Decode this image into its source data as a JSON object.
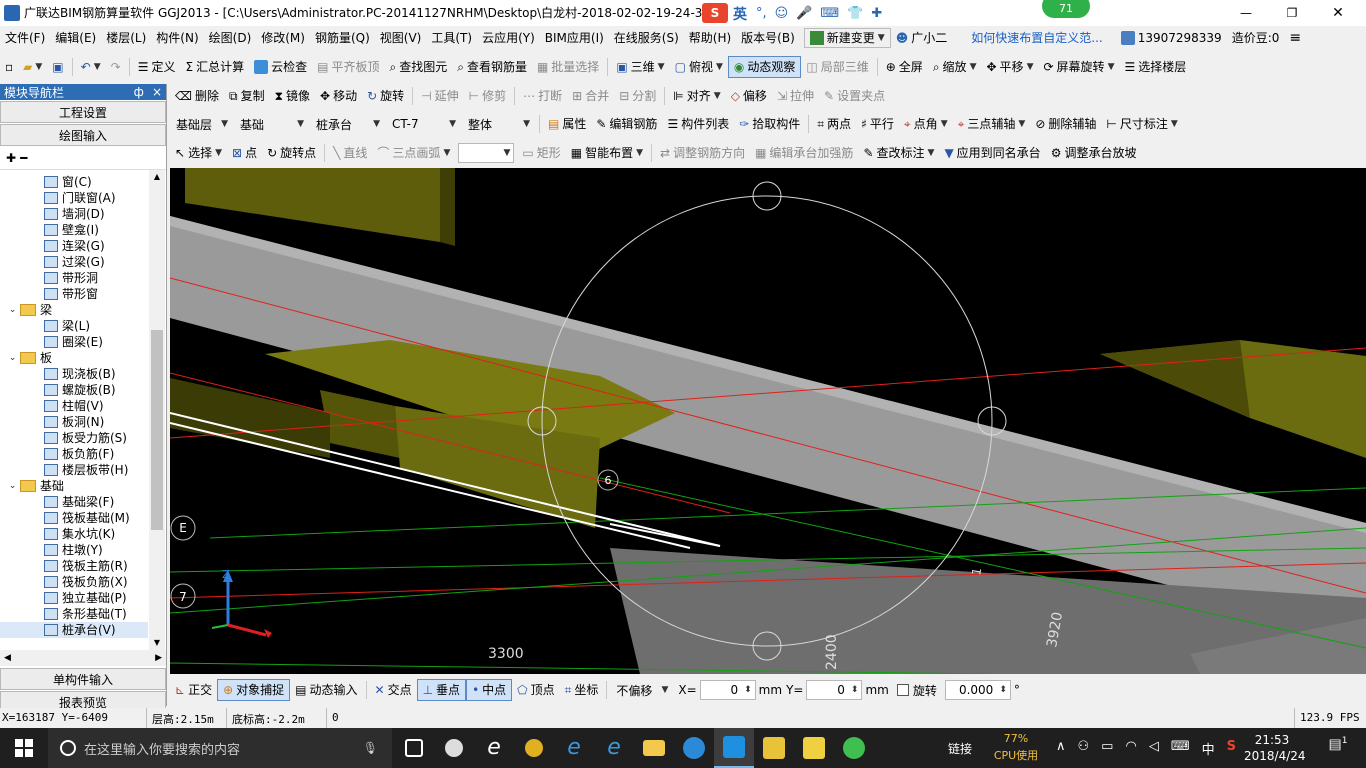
{
  "titlebar": {
    "title": "广联达BIM钢筋算量软件 GGJ2013 - [C:\\Users\\Administrator.PC-20141127NRHM\\Desktop\\白龙村-2018-02-02-19-24-35",
    "ime_label": "英",
    "badge_count": "71",
    "minimize": "—",
    "maximize": "❐",
    "close": "✕"
  },
  "menubar": {
    "items": [
      "文件(F)",
      "编辑(E)",
      "楼层(L)",
      "构件(N)",
      "绘图(D)",
      "修改(M)",
      "钢筋量(Q)",
      "视图(V)",
      "工具(T)",
      "云应用(Y)",
      "BIM应用(I)",
      "在线服务(S)",
      "帮助(H)",
      "版本号(B)"
    ],
    "new_change": "新建变更",
    "assistant": "广小二",
    "help_link": "如何快速布置自定义范...",
    "phone": "13907298339",
    "price_beans": "造价豆:0"
  },
  "toolbar1": {
    "define": "定义",
    "sum_calc": "汇总计算",
    "cloud_check": "云检查",
    "flush_slab_top": "平齐板顶",
    "find_element": "查找图元",
    "view_rebar": "查看钢筋量",
    "batch_select": "批量选择",
    "three_d": "三维",
    "top_view": "俯视",
    "dynamic_observe": "动态观察",
    "local_3d": "局部三维",
    "full_screen": "全屏",
    "zoom": "缩放",
    "pan": "平移",
    "screen_rotate": "屏幕旋转",
    "select_floor": "选择楼层"
  },
  "toolbar2": {
    "delete": "删除",
    "copy": "复制",
    "mirror": "镜像",
    "move": "移动",
    "rotate": "旋转",
    "extend": "延伸",
    "trim": "修剪",
    "break": "打断",
    "merge": "合并",
    "split": "分割",
    "align": "对齐",
    "offset": "偏移",
    "stretch": "拉伸",
    "set_grip": "设置夹点"
  },
  "toolbar3": {
    "floor": "基础层",
    "category": "基础",
    "element_type": "桩承台",
    "element_name": "CT-7",
    "unit": "整体",
    "properties": "属性",
    "edit_rebar": "编辑钢筋",
    "element_list": "构件列表",
    "pick_element": "拾取构件",
    "two_points": "两点",
    "parallel": "平行",
    "point_angle": "点角",
    "three_point_axis": "三点辅轴",
    "delete_axis": "删除辅轴",
    "dimension": "尺寸标注"
  },
  "toolbar4": {
    "select": "选择",
    "point": "点",
    "rotate_point": "旋转点",
    "line": "直线",
    "three_point_arc": "三点画弧",
    "rectangle": "矩形",
    "smart_layout": "智能布置",
    "adjust_rebar_dir": "调整钢筋方向",
    "edit_cap_rebar": "编辑承台加强筋",
    "modify_label": "查改标注",
    "apply_same_name": "应用到同名承台",
    "adjust_cap_slope": "调整承台放坡"
  },
  "nav": {
    "header": "模块导航栏",
    "pin": "ф",
    "close": "×",
    "engineering_settings": "工程设置",
    "drawing_input": "绘图输入",
    "tree": [
      {
        "label": "窗(C)",
        "kind": "item"
      },
      {
        "label": "门联窗(A)",
        "kind": "item"
      },
      {
        "label": "墙洞(D)",
        "kind": "item"
      },
      {
        "label": "壁龛(I)",
        "kind": "item"
      },
      {
        "label": "连梁(G)",
        "kind": "item"
      },
      {
        "label": "过梁(G)",
        "kind": "item"
      },
      {
        "label": "带形洞",
        "kind": "item"
      },
      {
        "label": "带形窗",
        "kind": "item"
      },
      {
        "label": "梁",
        "kind": "folder"
      },
      {
        "label": "梁(L)",
        "kind": "item"
      },
      {
        "label": "圈梁(E)",
        "kind": "item"
      },
      {
        "label": "板",
        "kind": "folder"
      },
      {
        "label": "现浇板(B)",
        "kind": "item"
      },
      {
        "label": "螺旋板(B)",
        "kind": "item"
      },
      {
        "label": "柱帽(V)",
        "kind": "item"
      },
      {
        "label": "板洞(N)",
        "kind": "item"
      },
      {
        "label": "板受力筋(S)",
        "kind": "item"
      },
      {
        "label": "板负筋(F)",
        "kind": "item"
      },
      {
        "label": "楼层板带(H)",
        "kind": "item"
      },
      {
        "label": "基础",
        "kind": "folder"
      },
      {
        "label": "基础梁(F)",
        "kind": "item"
      },
      {
        "label": "筏板基础(M)",
        "kind": "item"
      },
      {
        "label": "集水坑(K)",
        "kind": "item"
      },
      {
        "label": "柱墩(Y)",
        "kind": "item"
      },
      {
        "label": "筏板主筋(R)",
        "kind": "item"
      },
      {
        "label": "筏板负筋(X)",
        "kind": "item"
      },
      {
        "label": "独立基础(P)",
        "kind": "item"
      },
      {
        "label": "条形基础(T)",
        "kind": "item"
      },
      {
        "label": "桩承台(V)",
        "kind": "item"
      }
    ],
    "single_input": "单构件输入",
    "report_preview": "报表预览"
  },
  "viewport": {
    "axis_labels": {
      "e": "E",
      "seven": "7",
      "six": "6"
    },
    "dim_3300": "3300",
    "dim_2400": "2400",
    "dim_3920": "3920",
    "dim_one": "1",
    "axis_z": "Z",
    "colors": {
      "slab": "#9a9a9a",
      "cap": "#6b6b10",
      "red_line": "#e0201a",
      "green_line": "#12a212"
    }
  },
  "snapbar": {
    "ortho": "正交",
    "object_snap": "对象捕捉",
    "dynamic_input": "动态输入",
    "intersection": "交点",
    "perpendicular": "垂点",
    "midpoint": "中点",
    "vertex": "顶点",
    "coordinate": "坐标",
    "offset_mode": "不偏移",
    "x_label": "X=",
    "x_value": "0",
    "y_label": "Y=",
    "y_value": "0",
    "unit": "mm",
    "rotate_label": "旋转",
    "rotate_value": "0.000",
    "degree": "°"
  },
  "statusbar": {
    "coords": "X=163187 Y=-6409",
    "floor_height": "层高:2.15m",
    "bottom_elev": "底标高:-2.2m",
    "zero": "0",
    "fps": "123.9 FPS"
  },
  "taskbar": {
    "search_placeholder": "在这里输入你要搜索的内容",
    "link": "链接",
    "cpu_percent": "77%",
    "cpu_label": "CPU使用",
    "ime": "中",
    "time": "21:53",
    "date": "2018/4/24",
    "notify_count": "1"
  }
}
